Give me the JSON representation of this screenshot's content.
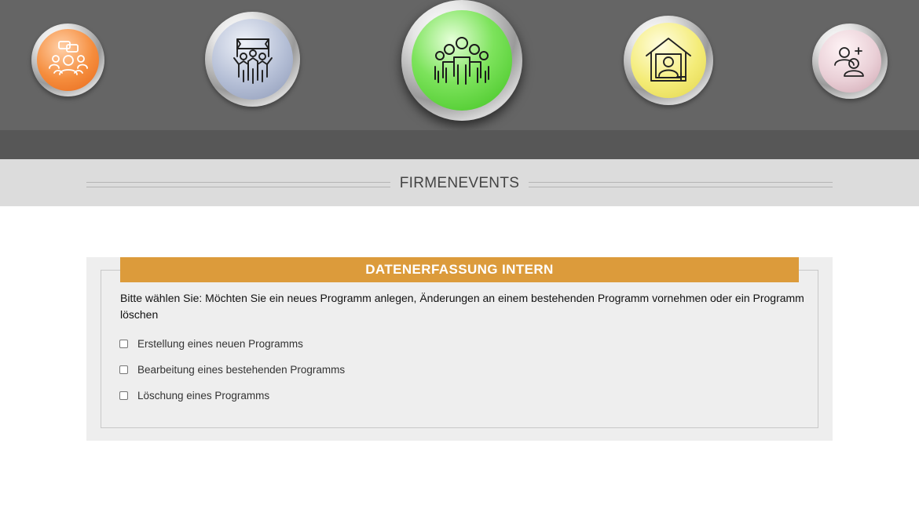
{
  "header": {
    "nav_buttons": [
      {
        "icon": "group-discussion-icon",
        "color": "#f08a3a"
      },
      {
        "icon": "team-celebration-icon",
        "color": "#a9b4cf"
      },
      {
        "icon": "company-group-icon",
        "color": "#5cd93e",
        "active": true
      },
      {
        "icon": "home-office-user-icon",
        "color": "#f2e96a"
      },
      {
        "icon": "add-user-icon",
        "color": "#e9c9d1"
      }
    ]
  },
  "page": {
    "title": "FIRMENEVENTS"
  },
  "form": {
    "legend": "DATENERFASSUNG INTERN",
    "question": "Bitte wählen Sie: Möchten Sie ein neues Programm anlegen, Änderungen an einem bestehenden Programm vornehmen oder ein Programm löschen",
    "options": [
      {
        "label": "Erstellung eines neuen Programms",
        "checked": false
      },
      {
        "label": "Bearbeitung eines bestehenden Programms",
        "checked": false
      },
      {
        "label": "Löschung eines Programms",
        "checked": false
      }
    ]
  }
}
